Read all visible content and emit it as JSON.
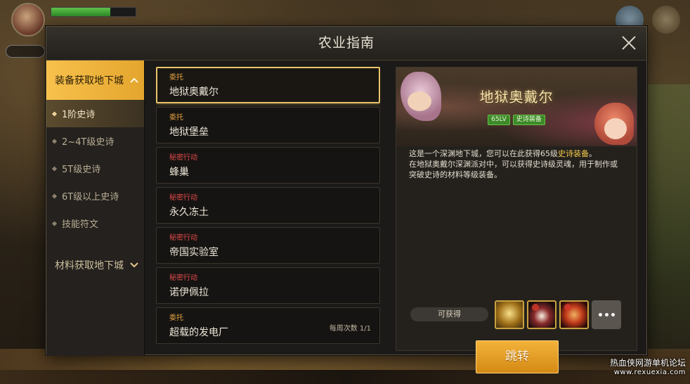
{
  "modal": {
    "title": "农业指南"
  },
  "sidebar": {
    "category1": "装备获取地下城",
    "items": [
      {
        "label": "1阶史诗"
      },
      {
        "label": "2~4T级史诗"
      },
      {
        "label": "5T级史诗"
      },
      {
        "label": "6T级以上史诗"
      },
      {
        "label": "技能符文"
      }
    ],
    "category2": "材料获取地下城"
  },
  "dungeons": [
    {
      "type": "委托",
      "name": "地狱奥戴尔",
      "selected": true
    },
    {
      "type": "委托",
      "name": "地狱堡垒"
    },
    {
      "type": "秘密行动",
      "name": "蜂巢"
    },
    {
      "type": "秘密行动",
      "name": "永久冻土"
    },
    {
      "type": "秘密行动",
      "name": "帝国实验室"
    },
    {
      "type": "秘密行动",
      "name": "诺伊佩拉"
    },
    {
      "type": "委托",
      "name": "超载的发电厂",
      "weekly": "每周次数 1/1"
    }
  ],
  "detail": {
    "title": "地狱奥戴尔",
    "level_tag": "65LV",
    "type_tag": "史诗装备",
    "desc_part1": "这是一个深渊地下城，您可以在此获得65级",
    "desc_highlight": "史诗装备",
    "desc_part2": "。",
    "desc_line2": "在地狱奥戴尔深渊派对中，可以获得史诗级灵魂，用于制作或突破史诗的材料等级装备。",
    "obtain_label": "可获得",
    "jump_label": "跳转"
  },
  "watermark": {
    "line1": "热血侠网游单机论坛",
    "line2": "www.rexuexia.com"
  },
  "colors": {
    "accent_gold": "#f7c14c",
    "commission_type": "#e6a33e",
    "secret_type": "#e24a4a",
    "highlight": "#f2c94c",
    "tag_green": "#3e8a2a"
  }
}
